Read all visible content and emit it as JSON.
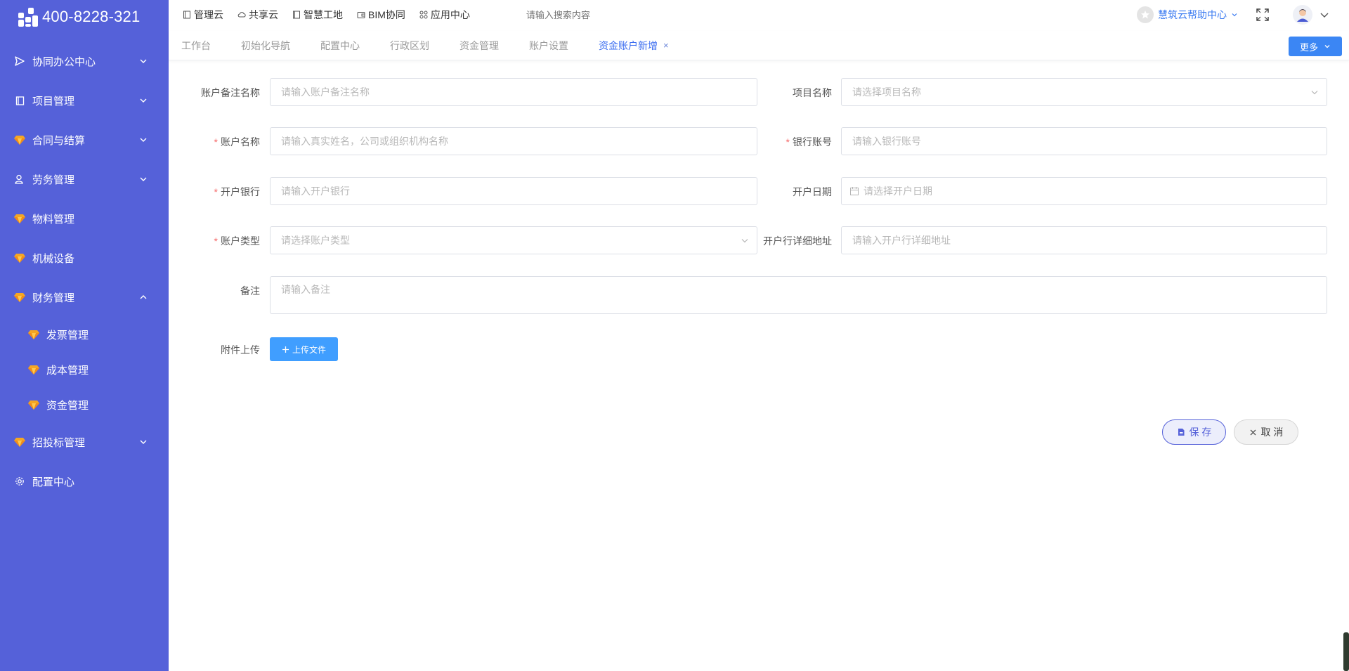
{
  "app": {
    "phone": "400-8228-321"
  },
  "colors": {
    "sidebar_bg": "#5561d9",
    "accent_blue": "#409eff",
    "required": "#f56c6c"
  },
  "sidebar": {
    "items": [
      {
        "label": "协同办公中心",
        "icon": "send-icon",
        "arrow": "down"
      },
      {
        "label": "项目管理",
        "icon": "book-icon",
        "arrow": "down"
      },
      {
        "label": "合同与结算",
        "icon": "gem-icon",
        "arrow": "down"
      },
      {
        "label": "劳务管理",
        "icon": "user-icon",
        "arrow": "down"
      },
      {
        "label": "物料管理",
        "icon": "gem-icon"
      },
      {
        "label": "机械设备",
        "icon": "gem-icon"
      },
      {
        "label": "财务管理",
        "icon": "gem-icon",
        "arrow": "up"
      },
      {
        "label": "招投标管理",
        "icon": "gem-icon",
        "arrow": "down"
      },
      {
        "label": "配置中心",
        "icon": "gear-icon"
      }
    ],
    "finance_sub": [
      {
        "label": "发票管理"
      },
      {
        "label": "成本管理"
      },
      {
        "label": "资金管理"
      }
    ]
  },
  "topnav": {
    "items": [
      {
        "label": "管理云"
      },
      {
        "label": "共享云"
      },
      {
        "label": "智慧工地"
      },
      {
        "label": "BIM协同"
      },
      {
        "label": "应用中心"
      }
    ],
    "search_placeholder": "请输入搜索内容",
    "help_label": "慧筑云帮助中心"
  },
  "tabs": {
    "items": [
      {
        "label": "工作台"
      },
      {
        "label": "初始化导航"
      },
      {
        "label": "配置中心"
      },
      {
        "label": "行政区划"
      },
      {
        "label": "资金管理"
      },
      {
        "label": "账户设置"
      },
      {
        "label": "资金账户新增"
      }
    ],
    "close_glyph": "×",
    "more_label": "更多"
  },
  "form": {
    "account_note": {
      "label": "账户备注名称",
      "placeholder": "请输入账户备注名称"
    },
    "project_name": {
      "label": "项目名称",
      "placeholder": "请选择项目名称"
    },
    "account_name": {
      "label": "账户名称",
      "placeholder": "请输入真实姓名，公司或组织机构名称",
      "required": "*"
    },
    "bank_account": {
      "label": "银行账号",
      "placeholder": "请输入银行账号",
      "required": "*"
    },
    "bank": {
      "label": "开户银行",
      "placeholder": "请输入开户银行",
      "required": "*"
    },
    "open_date": {
      "label": "开户日期",
      "placeholder": "请选择开户日期"
    },
    "account_type": {
      "label": "账户类型",
      "placeholder": "请选择账户类型",
      "required": "*"
    },
    "bank_address": {
      "label": "开户行详细地址",
      "placeholder": "请输入开户行详细地址"
    },
    "remark": {
      "label": "备注",
      "placeholder": "请输入备注"
    },
    "attachment": {
      "label": "附件上传",
      "button": "上传文件"
    }
  },
  "actions": {
    "save": "保 存",
    "cancel": "取 消"
  }
}
